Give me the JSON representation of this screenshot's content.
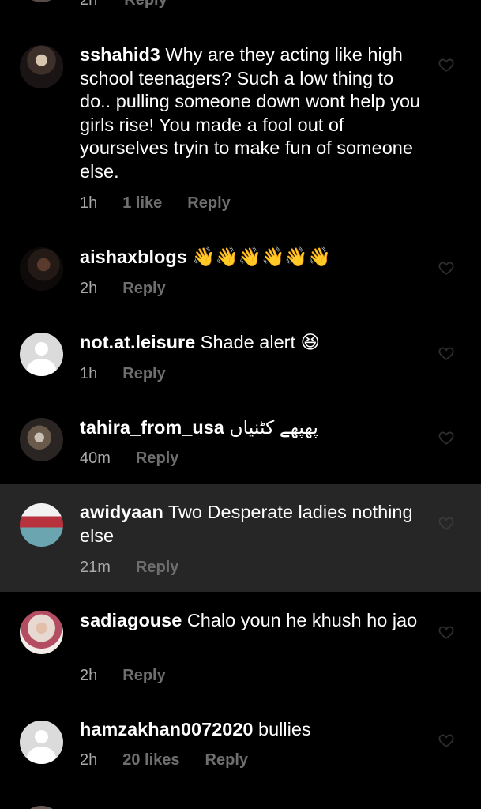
{
  "top_partial": {
    "time": "2h",
    "reply_label": "Reply"
  },
  "comments": [
    {
      "username": "sshahid3",
      "text": "Why are they acting like high school teenagers?  Such a low thing to do.. pulling someone down wont help you girls rise! You made a fool out of yourselves tryin to make fun of someone else.",
      "time": "1h",
      "likes": "1 like",
      "reply_label": "Reply",
      "avatar": "user-photo"
    },
    {
      "username": "aishaxblogs",
      "text": "👋👋👋👋👋👋",
      "time": "2h",
      "reply_label": "Reply",
      "avatar": "user-photo"
    },
    {
      "username": "not.at.leisure",
      "text": "Shade alert 😆",
      "time": "1h",
      "reply_label": "Reply",
      "avatar": "default-avatar"
    },
    {
      "username": "tahira_from_usa",
      "text": "پھپھے کٹنیاں",
      "time": "40m",
      "reply_label": "Reply",
      "avatar": "user-photo"
    },
    {
      "username": "awidyaan",
      "text": "Two Desperate ladies nothing else",
      "time": "21m",
      "reply_label": "Reply",
      "avatar": "user-photo",
      "highlighted": true
    },
    {
      "username": "sadiagouse",
      "text": "Chalo youn he khush ho jao",
      "time": "2h",
      "reply_label": "Reply",
      "avatar": "user-photo"
    },
    {
      "username": "hamzakhan0072020",
      "text": "bullies",
      "time": "2h",
      "likes": "20 likes",
      "reply_label": "Reply",
      "avatar": "default-avatar"
    }
  ],
  "icons": {
    "like": "heart-outline-icon",
    "default_avatar": "user-silhouette-icon"
  },
  "colors": {
    "background": "#000000",
    "highlight": "#262626",
    "primary_text": "#ffffff",
    "secondary_text": "#a8a8a8",
    "muted_text": "#6e6e6e"
  }
}
